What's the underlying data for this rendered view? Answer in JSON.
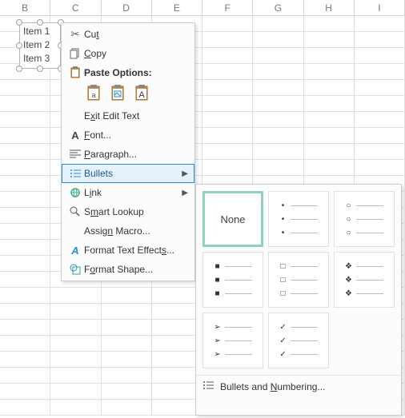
{
  "columns": [
    "B",
    "C",
    "D",
    "E",
    "F",
    "G",
    "H",
    "I"
  ],
  "textbox": {
    "lines": [
      "Item 1",
      "Item 2",
      "Item 3"
    ]
  },
  "menu": {
    "cut": "Cut",
    "copy": "Copy",
    "paste_header": "Paste Options:",
    "exit_edit": "Exit Edit Text",
    "font": "Font...",
    "paragraph": "Paragraph...",
    "bullets": "Bullets",
    "link": "Link",
    "smart_lookup": "Smart Lookup",
    "assign_macro": "Assign Macro...",
    "format_effects": "Format Text Effects...",
    "format_shape": "Format Shape..."
  },
  "gallery": {
    "none_label": "None",
    "footer": "Bullets and Numbering..."
  },
  "chart_data": null
}
